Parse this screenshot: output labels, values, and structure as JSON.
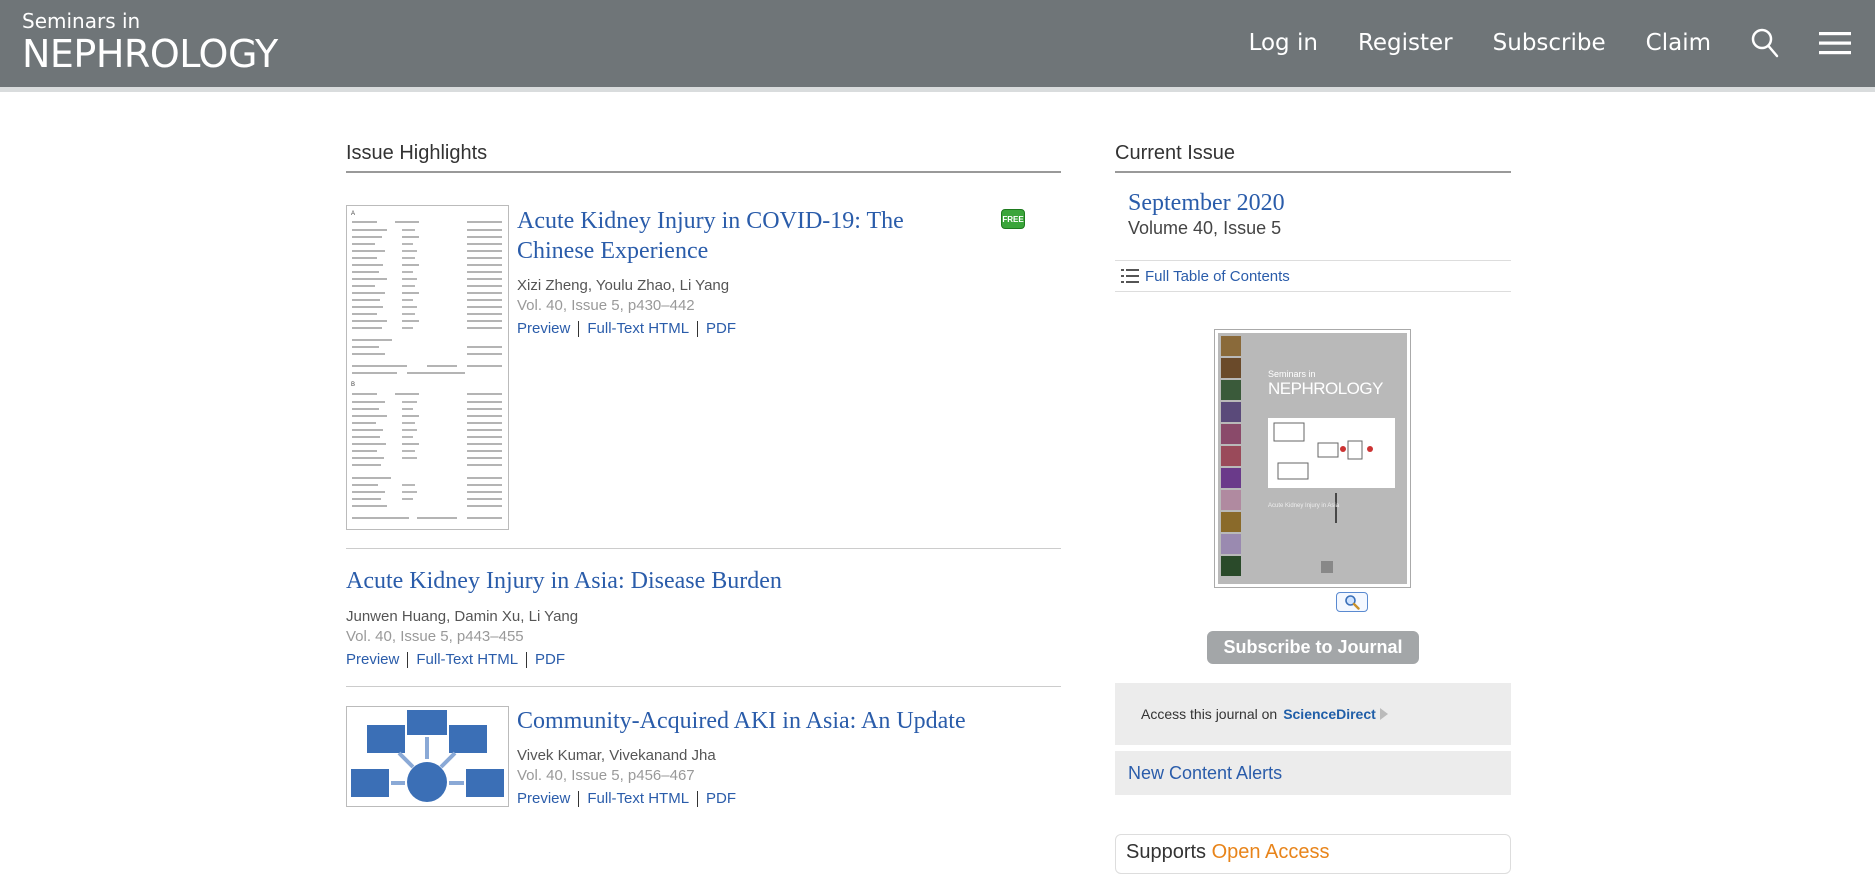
{
  "header": {
    "logo_small": "Seminars in",
    "logo_big": "NEPHROLOGY",
    "nav": [
      "Log in",
      "Register",
      "Subscribe",
      "Claim"
    ],
    "search_icon": "search-icon",
    "menu_icon": "hamburger-menu-icon"
  },
  "highlights": {
    "heading": "Issue Highlights",
    "free_badge": "FREE",
    "articles": [
      {
        "title": "Acute Kidney Injury in COVID-19: The Chinese Experience",
        "authors": "Xizi Zheng, Youlu Zhao, Li Yang",
        "volume": "Vol. 40, Issue 5, p430–442",
        "links": [
          "Preview",
          "Full-Text HTML",
          "PDF"
        ]
      },
      {
        "title": "Acute Kidney Injury in Asia: Disease Burden",
        "authors": "Junwen Huang, Damin Xu, Li Yang",
        "volume": "Vol. 40, Issue 5, p443–455",
        "links": [
          "Preview",
          "Full-Text HTML",
          "PDF"
        ]
      },
      {
        "title": "Community-Acquired AKI in Asia: An Update",
        "authors": "Vivek Kumar, Vivekanand Jha",
        "volume": "Vol. 40, Issue 5, p456–467",
        "links": [
          "Preview",
          "Full-Text HTML",
          "PDF"
        ]
      }
    ]
  },
  "current_issue": {
    "heading": "Current Issue",
    "date": "September 2020",
    "volume": "Volume 40, Issue 5",
    "toc_label": "Full Table of Contents",
    "cover": {
      "journal_small": "Seminars in",
      "journal_big": "NEPHROLOGY",
      "subtitle": "Acute Kidney Injury in Asia"
    },
    "subscribe_label": "Subscribe to Journal",
    "access_text": "Access this journal on",
    "access_link": "ScienceDirect",
    "alerts_label": "New Content Alerts",
    "supports_text": "Supports",
    "open_access": "Open Access"
  },
  "colors": {
    "header_bg": "#6f7578",
    "link": "#2a5caa",
    "open_access": "#e8841a"
  }
}
